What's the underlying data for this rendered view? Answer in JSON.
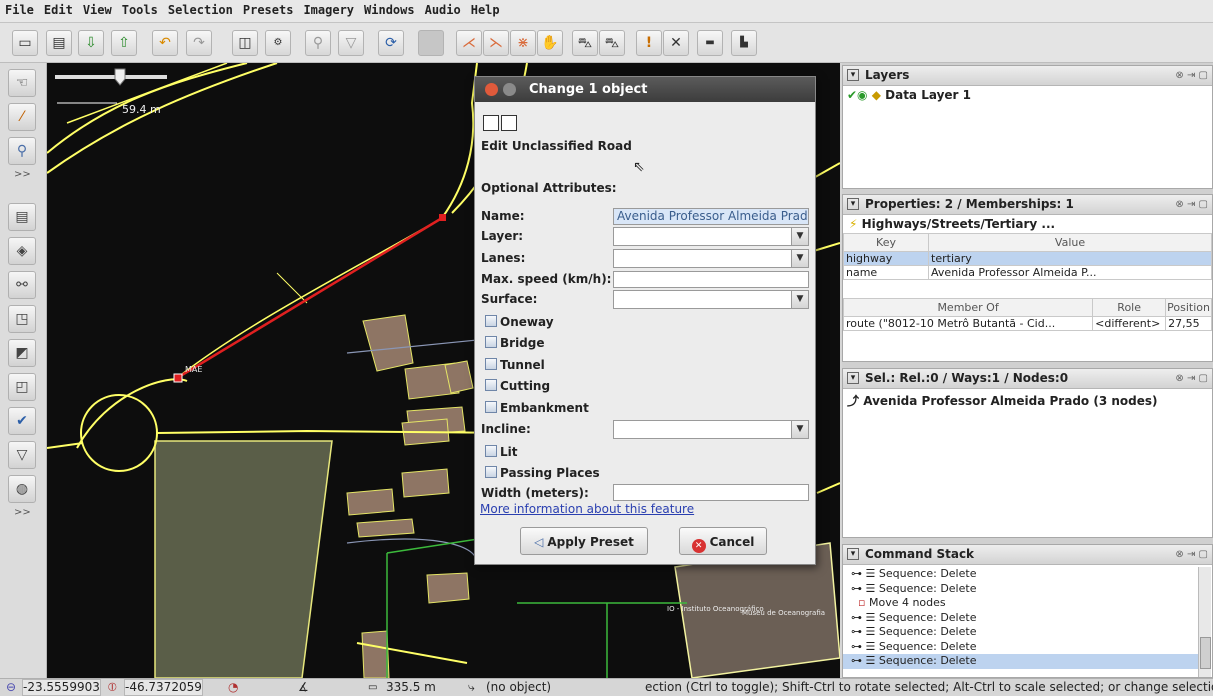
{
  "menu": [
    "File",
    "Edit",
    "View",
    "Tools",
    "Selection",
    "Presets",
    "Imagery",
    "Windows",
    "Audio",
    "Help"
  ],
  "map": {
    "scale_label": "59.4 m",
    "node_label": "MAE",
    "poi_label": "IO - Instituto Oceanográfico",
    "museum_label": "Museu de Oceanografia"
  },
  "dialog": {
    "title": "Change 1 object",
    "heading": "Edit Unclassified Road",
    "optional_attributes": "Optional Attributes:",
    "fields": {
      "name_label": "Name:",
      "name_value": "Avenida Professor Almeida Prado",
      "layer_label": "Layer:",
      "lanes_label": "Lanes:",
      "maxspeed_label": "Max. speed (km/h):",
      "surface_label": "Surface:",
      "incline_label": "Incline:",
      "width_label": "Width (meters):"
    },
    "checkboxes": {
      "oneway": "Oneway",
      "bridge": "Bridge",
      "tunnel": "Tunnel",
      "cutting": "Cutting",
      "embankment": "Embankment",
      "lit": "Lit",
      "passing_places": "Passing Places"
    },
    "more_info": "More information about this feature",
    "apply_label": "Apply Preset",
    "cancel_label": "Cancel"
  },
  "layers_panel": {
    "title": "Layers",
    "layer_name": "Data Layer 1"
  },
  "properties_panel": {
    "title": "Properties: 2 / Memberships: 1",
    "preset_name": "Highways/Streets/Tertiary ...",
    "key_header": "Key",
    "value_header": "Value",
    "rows": [
      {
        "key": "highway",
        "value": "tertiary"
      },
      {
        "key": "name",
        "value": "Avenida Professor Almeida P..."
      }
    ],
    "member_of_header": "Member Of",
    "role_header": "Role",
    "position_header": "Position",
    "membership": {
      "member_of": "route (\"8012-10 Metrô Butantã - Cid...",
      "role": "<different>",
      "position": "27,55"
    }
  },
  "selection_panel": {
    "title": "Sel.: Rel.:0 / Ways:1 / Nodes:0",
    "item": "Avenida Professor Almeida Prado (3 nodes)"
  },
  "command_panel": {
    "title": "Command Stack",
    "items": [
      "Sequence: Delete",
      "Sequence: Delete",
      "Move 4 nodes",
      "Sequence: Delete",
      "Sequence: Delete",
      "Sequence: Delete",
      "Sequence: Delete"
    ]
  },
  "status": {
    "lat": "-23.5559903",
    "lon": "-46.7372059",
    "distance": "335.5 m",
    "object": "(no object)",
    "help": "ection (Ctrl to toggle); Shift-Ctrl to rotate selected; Alt-Ctrl to scale selected; or change selection"
  },
  "colors": {
    "selected_way": "#e02020",
    "road": "#ffff66",
    "building": "#c9a089",
    "dialog_title": "#4a4a4a"
  }
}
